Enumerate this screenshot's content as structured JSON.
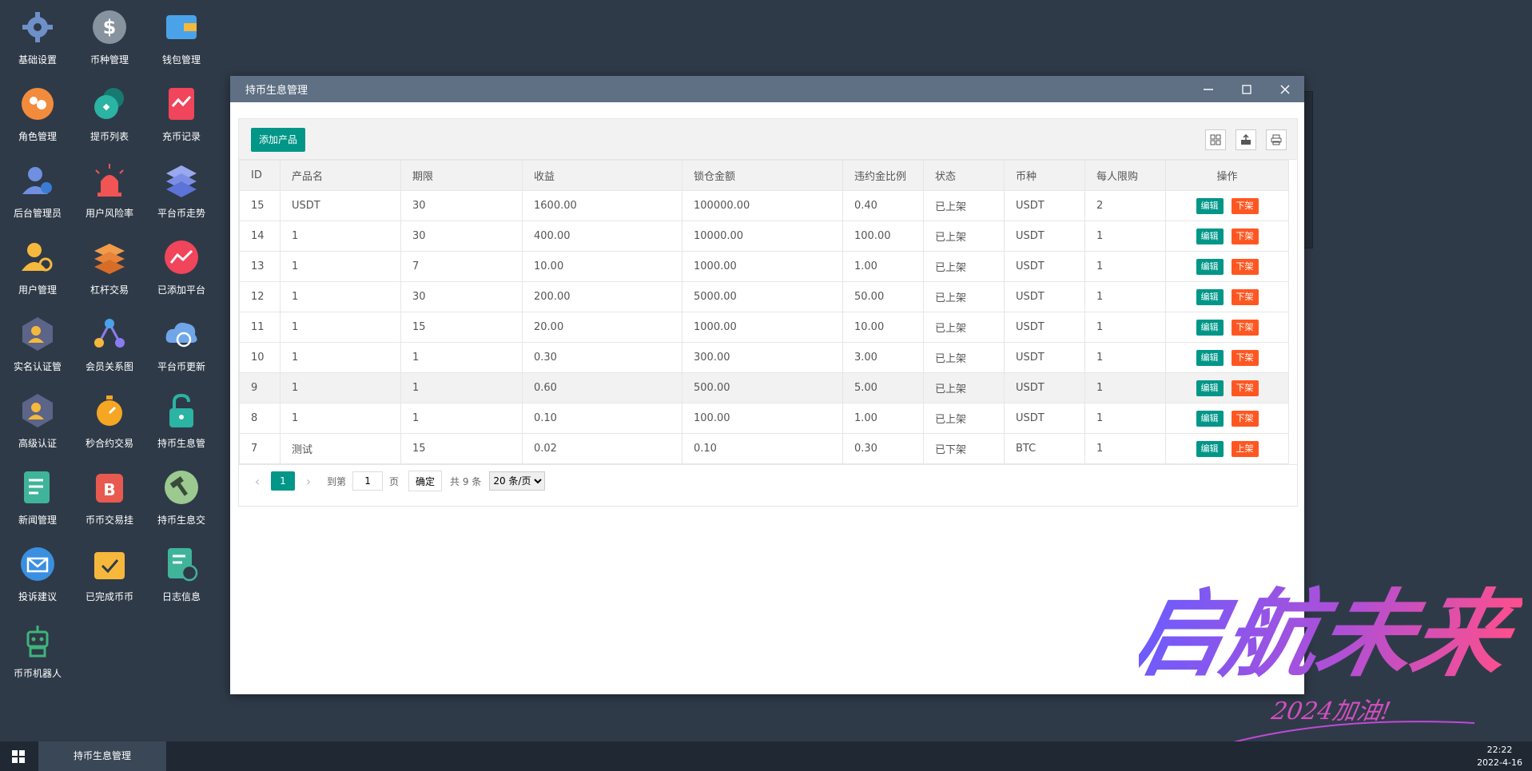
{
  "desktop": {
    "icons": [
      {
        "label": "基础设置",
        "icon": "gear-icon"
      },
      {
        "label": "币种管理",
        "icon": "dollar-icon"
      },
      {
        "label": "钱包管理",
        "icon": "wallet-icon"
      },
      {
        "label": "角色管理",
        "icon": "roles-icon"
      },
      {
        "label": "提币列表",
        "icon": "withdraw-icon"
      },
      {
        "label": "充币记录",
        "icon": "deposit-icon"
      },
      {
        "label": "后台管理员",
        "icon": "admin-icon"
      },
      {
        "label": "用户风险率",
        "icon": "alarm-icon"
      },
      {
        "label": "平台币走势",
        "icon": "layers-icon"
      },
      {
        "label": "用户管理",
        "icon": "user-search-icon"
      },
      {
        "label": "杠杆交易",
        "icon": "stack-icon"
      },
      {
        "label": "已添加平台",
        "icon": "trend-icon"
      },
      {
        "label": "实名认证管",
        "icon": "verify-icon"
      },
      {
        "label": "会员关系图",
        "icon": "network-icon"
      },
      {
        "label": "平台币更新",
        "icon": "cloud-refresh-icon"
      },
      {
        "label": "高级认证",
        "icon": "verify-advanced-icon"
      },
      {
        "label": "秒合约交易",
        "icon": "stopwatch-icon"
      },
      {
        "label": "持币生息管",
        "icon": "unlock-icon"
      },
      {
        "label": "新闻管理",
        "icon": "news-icon"
      },
      {
        "label": "币币交易挂",
        "icon": "bitcoin-icon"
      },
      {
        "label": "持币生息交",
        "icon": "hammer-icon"
      },
      {
        "label": "投诉建议",
        "icon": "mail-icon"
      },
      {
        "label": "已完成币币",
        "icon": "check-folder-icon"
      },
      {
        "label": "日志信息",
        "icon": "log-icon"
      },
      {
        "label": "币币机器人",
        "icon": "robot-icon"
      }
    ]
  },
  "window": {
    "title": "持币生息管理",
    "add_button": "添加产品",
    "tools": [
      "columns-icon",
      "export-icon",
      "print-icon"
    ],
    "columns": [
      "ID",
      "产品名",
      "期限",
      "收益",
      "锁仓金额",
      "违约金比例",
      "状态",
      "币种",
      "每人限购",
      "操作"
    ],
    "rows": [
      {
        "id": "15",
        "name": "USDT",
        "term": "30",
        "yield": "1600.00",
        "locked": "100000.00",
        "penalty": "0.40",
        "status": "已上架",
        "coin": "USDT",
        "limit": "2",
        "edit": "编辑",
        "toggle": "下架"
      },
      {
        "id": "14",
        "name": "1",
        "term": "30",
        "yield": "400.00",
        "locked": "10000.00",
        "penalty": "100.00",
        "status": "已上架",
        "coin": "USDT",
        "limit": "1",
        "edit": "编辑",
        "toggle": "下架"
      },
      {
        "id": "13",
        "name": "1",
        "term": "7",
        "yield": "10.00",
        "locked": "1000.00",
        "penalty": "1.00",
        "status": "已上架",
        "coin": "USDT",
        "limit": "1",
        "edit": "编辑",
        "toggle": "下架"
      },
      {
        "id": "12",
        "name": "1",
        "term": "30",
        "yield": "200.00",
        "locked": "5000.00",
        "penalty": "50.00",
        "status": "已上架",
        "coin": "USDT",
        "limit": "1",
        "edit": "编辑",
        "toggle": "下架"
      },
      {
        "id": "11",
        "name": "1",
        "term": "15",
        "yield": "20.00",
        "locked": "1000.00",
        "penalty": "10.00",
        "status": "已上架",
        "coin": "USDT",
        "limit": "1",
        "edit": "编辑",
        "toggle": "下架"
      },
      {
        "id": "10",
        "name": "1",
        "term": "1",
        "yield": "0.30",
        "locked": "300.00",
        "penalty": "3.00",
        "status": "已上架",
        "coin": "USDT",
        "limit": "1",
        "edit": "编辑",
        "toggle": "下架"
      },
      {
        "id": "9",
        "name": "1",
        "term": "1",
        "yield": "0.60",
        "locked": "500.00",
        "penalty": "5.00",
        "status": "已上架",
        "coin": "USDT",
        "limit": "1",
        "edit": "编辑",
        "toggle": "下架",
        "highlight": true
      },
      {
        "id": "8",
        "name": "1",
        "term": "1",
        "yield": "0.10",
        "locked": "100.00",
        "penalty": "1.00",
        "status": "已上架",
        "coin": "USDT",
        "limit": "1",
        "edit": "编辑",
        "toggle": "下架"
      },
      {
        "id": "7",
        "name": "测试",
        "term": "15",
        "yield": "0.02",
        "locked": "0.10",
        "penalty": "0.30",
        "status": "已下架",
        "coin": "BTC",
        "limit": "1",
        "edit": "编辑",
        "toggle": "上架"
      }
    ],
    "pager": {
      "current": "1",
      "goto_label": "到第",
      "goto_value": "1",
      "page_unit": "页",
      "ok_label": "确定",
      "total": "共 9 条",
      "page_size": "20 条/页"
    }
  },
  "taskbar": {
    "task_label": "持币生息管理",
    "time": "22:22",
    "date": "2022-4-16"
  },
  "watermark": {
    "text": "启航未来",
    "sub": "2024加油!"
  },
  "colors": {
    "accent": "#009688",
    "danger": "#ff5722",
    "titlebar": "#5f7084",
    "desktop": "#2f3a48"
  }
}
